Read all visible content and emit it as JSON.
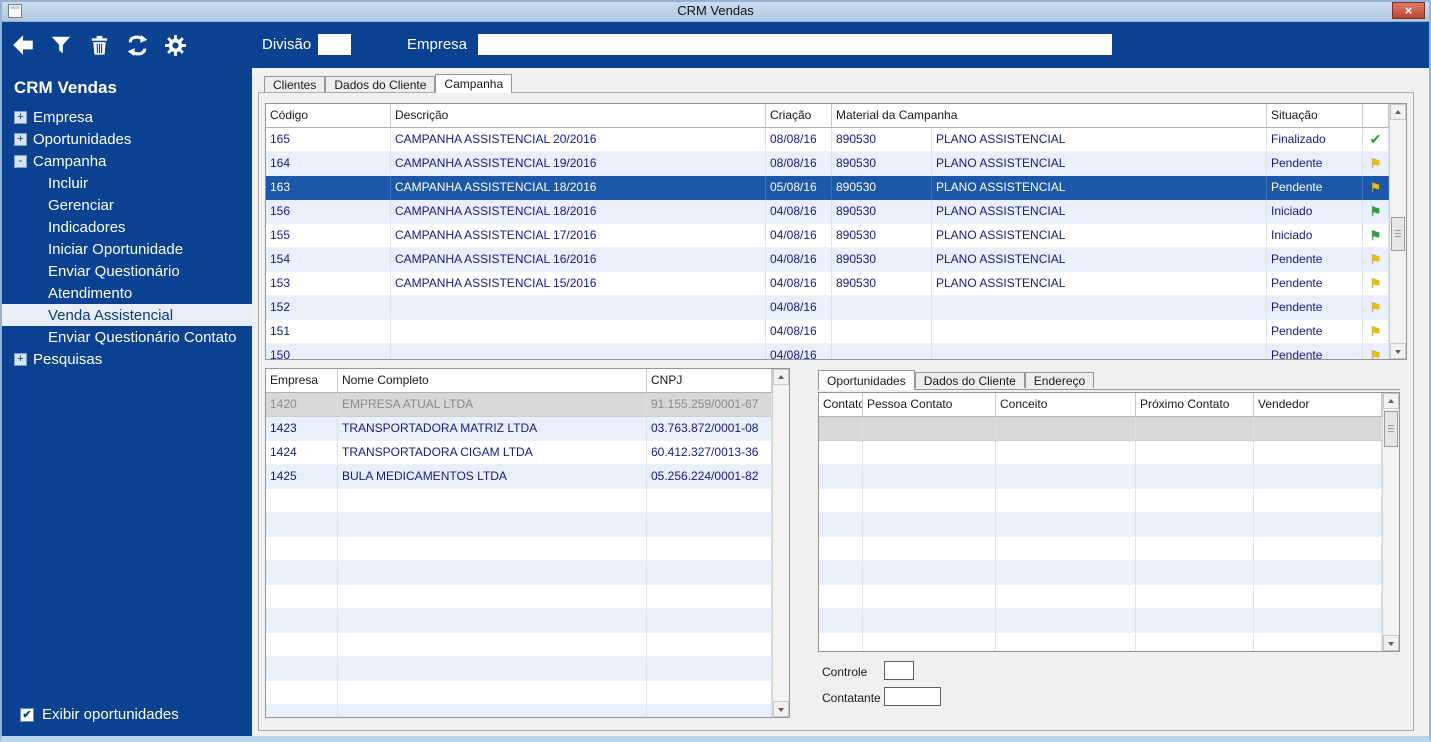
{
  "titlebar": {
    "title": "CRM Vendas",
    "close_glyph": "×"
  },
  "toolbar": {
    "division_label": "Divisão",
    "division_value": "",
    "company_label": "Empresa",
    "company_value": ""
  },
  "sidebar": {
    "title": "CRM Vendas",
    "items": [
      {
        "label": "Empresa",
        "expand": "+"
      },
      {
        "label": "Oportunidades",
        "expand": "+"
      },
      {
        "label": "Campanha",
        "expand": "-"
      },
      {
        "label": "Incluir"
      },
      {
        "label": "Gerenciar"
      },
      {
        "label": "Indicadores"
      },
      {
        "label": "Iniciar Oportunidade"
      },
      {
        "label": "Enviar Questionário"
      },
      {
        "label": "Atendimento"
      },
      {
        "label": "Venda Assistencial"
      },
      {
        "label": "Enviar Questionário Contato"
      },
      {
        "label": "Pesquisas",
        "expand": "+"
      }
    ],
    "checkbox_label": "Exibir oportunidades",
    "checkbox_checked": true,
    "checkbox_glyph": "✔"
  },
  "main": {
    "tabs": [
      "Clientes",
      "Dados do Cliente",
      "Campanha"
    ],
    "active_tab": "Campanha"
  },
  "campaign_grid": {
    "headers": [
      "Código",
      "Descrição",
      "Criação",
      "Material da Campanha",
      "Situação"
    ],
    "rows": [
      {
        "codigo": "165",
        "descricao": "CAMPANHA ASSISTENCIAL 20/2016",
        "criacao": "08/08/16",
        "mat_cod": "890530",
        "mat_nome": "PLANO ASSISTENCIAL",
        "situacao": "Finalizado",
        "icon_name": "check-green",
        "icon_glyph": "✔",
        "icon_cls": "ic-check"
      },
      {
        "codigo": "164",
        "descricao": "CAMPANHA ASSISTENCIAL 19/2016",
        "criacao": "08/08/16",
        "mat_cod": "890530",
        "mat_nome": "PLANO ASSISTENCIAL",
        "situacao": "Pendente",
        "icon_name": "flag-yellow",
        "icon_glyph": "⚑",
        "icon_cls": "ic-flag-yellow"
      },
      {
        "codigo": "163",
        "descricao": "CAMPANHA ASSISTENCIAL 18/2016",
        "criacao": "05/08/16",
        "mat_cod": "890530",
        "mat_nome": "PLANO ASSISTENCIAL",
        "situacao": "Pendente",
        "selected": true,
        "icon_name": "flag-yellow",
        "icon_glyph": "⚑",
        "icon_cls": "ic-flag-yellow"
      },
      {
        "codigo": "156",
        "descricao": "CAMPANHA ASSISTENCIAL 18/2016",
        "criacao": "04/08/16",
        "mat_cod": "890530",
        "mat_nome": "PLANO ASSISTENCIAL",
        "situacao": "Iniciado",
        "icon_name": "flag-green",
        "icon_glyph": "⚑",
        "icon_cls": "ic-flag-green"
      },
      {
        "codigo": "155",
        "descricao": "CAMPANHA ASSISTENCIAL 17/2016",
        "criacao": "04/08/16",
        "mat_cod": "890530",
        "mat_nome": "PLANO ASSISTENCIAL",
        "situacao": "Iniciado",
        "icon_name": "flag-green",
        "icon_glyph": "⚑",
        "icon_cls": "ic-flag-green"
      },
      {
        "codigo": "154",
        "descricao": "CAMPANHA ASSISTENCIAL 16/2016",
        "criacao": "04/08/16",
        "mat_cod": "890530",
        "mat_nome": "PLANO ASSISTENCIAL",
        "situacao": "Pendente",
        "icon_name": "flag-yellow",
        "icon_glyph": "⚑",
        "icon_cls": "ic-flag-yellow"
      },
      {
        "codigo": "153",
        "descricao": "CAMPANHA ASSISTENCIAL 15/2016",
        "criacao": "04/08/16",
        "mat_cod": "890530",
        "mat_nome": "PLANO ASSISTENCIAL",
        "situacao": "Pendente",
        "icon_name": "flag-yellow",
        "icon_glyph": "⚑",
        "icon_cls": "ic-flag-yellow"
      },
      {
        "codigo": "152",
        "descricao": "",
        "criacao": "04/08/16",
        "mat_cod": "",
        "mat_nome": "",
        "situacao": "Pendente",
        "icon_name": "flag-yellow",
        "icon_glyph": "⚑",
        "icon_cls": "ic-flag-yellow"
      },
      {
        "codigo": "151",
        "descricao": "",
        "criacao": "04/08/16",
        "mat_cod": "",
        "mat_nome": "",
        "situacao": "Pendente",
        "icon_name": "flag-yellow",
        "icon_glyph": "⚑",
        "icon_cls": "ic-flag-yellow"
      },
      {
        "codigo": "150",
        "descricao": "",
        "criacao": "04/08/16",
        "mat_cod": "",
        "mat_nome": "",
        "situacao": "Pendente",
        "icon_name": "flag-yellow",
        "icon_glyph": "⚑",
        "icon_cls": "ic-flag-yellow"
      }
    ]
  },
  "company_grid": {
    "headers": [
      "Empresa",
      "Nome Completo",
      "CNPJ"
    ],
    "rows": [
      {
        "empresa": "1420",
        "nome": "EMPRESA ATUAL LTDA",
        "cnpj": "91.155.259/0001-67",
        "state": "muted-selected"
      },
      {
        "empresa": "1423",
        "nome": "TRANSPORTADORA MATRIZ  LTDA",
        "cnpj": "03.763.872/0001-08"
      },
      {
        "empresa": "1424",
        "nome": "TRANSPORTADORA CIGAM LTDA",
        "cnpj": "60.412.327/0013-36"
      },
      {
        "empresa": "1425",
        "nome": "BULA MEDICAMENTOS LTDA",
        "cnpj": "05.256.224/0001-82"
      }
    ]
  },
  "detail": {
    "tabs": [
      "Oportunidades",
      "Dados do Cliente",
      "Endereço"
    ],
    "active_tab": "Oportunidades",
    "headers": [
      "Contato",
      "Pessoa Contato",
      "Conceito",
      "Próximo Contato",
      "Vendedor"
    ],
    "controle_label": "Controle",
    "controle_value": "",
    "contatante_label": "Contatante",
    "contatante_value": ""
  },
  "colors": {
    "accent_blue": "#0a4191",
    "selected_row": "#1d57a9",
    "row_alt": "#e9effb",
    "check_green": "#1fa332",
    "flag_yellow": "#e7bd13",
    "flag_green": "#2f9e3d"
  }
}
